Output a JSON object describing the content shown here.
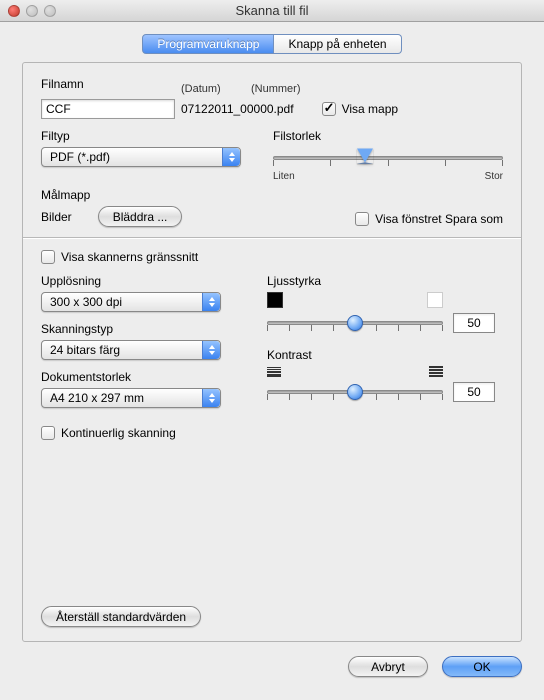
{
  "window": {
    "title": "Skanna till fil"
  },
  "tabs": {
    "software": "Programvaruknapp",
    "device": "Knapp på enheten"
  },
  "filename": {
    "label": "Filnamn",
    "date_hdr": "(Datum)",
    "number_hdr": "(Nummer)",
    "value": "CCF",
    "generated": "07122011_00000.pdf",
    "show_folder": "Visa mapp"
  },
  "filetype": {
    "label": "Filtyp",
    "value": "PDF (*.pdf)"
  },
  "filesize": {
    "label": "Filstorlek",
    "small": "Liten",
    "large": "Stor",
    "pct": 40
  },
  "destfolder": {
    "label": "Målmapp",
    "value": "Bilder",
    "browse": "Bläddra ...",
    "show_saveas": "Visa fönstret Spara som"
  },
  "scanner_interface": "Visa skannerns gränssnitt",
  "resolution": {
    "label": "Upplösning",
    "value": "300 x 300 dpi"
  },
  "scantype": {
    "label": "Skanningstyp",
    "value": "24 bitars färg"
  },
  "docsize": {
    "label": "Dokumentstorlek",
    "value": "A4 210 x 297 mm"
  },
  "continuous": "Kontinuerlig skanning",
  "brightness": {
    "label": "Ljusstyrka",
    "value": "50",
    "pct": 50
  },
  "contrast": {
    "label": "Kontrast",
    "value": "50",
    "pct": 50
  },
  "reset": "Återställ standardvärden",
  "buttons": {
    "cancel": "Avbryt",
    "ok": "OK"
  }
}
